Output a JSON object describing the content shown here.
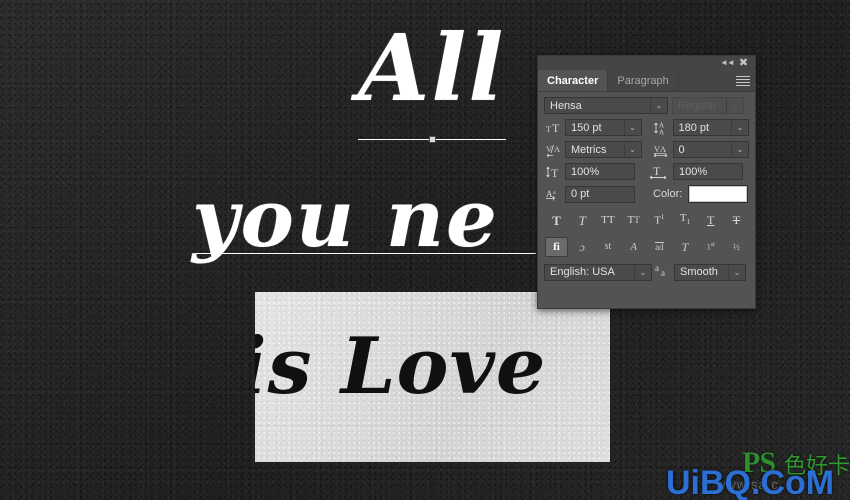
{
  "canvas": {
    "line1": "All",
    "line2": "you ne",
    "line3": "is Love",
    "background_color": "#252525",
    "text_color": "#ffffff",
    "box_background": "#dcdcdc",
    "box_text_color": "#101010"
  },
  "watermark": {
    "ps_logo": "PS",
    "cn_logo": "色好卡",
    "domain": "UiBQ.CoM",
    "sub": "www.sa.c",
    "blue": "#2b6fd4",
    "green": "#2d8f2d"
  },
  "panel": {
    "titlebar": {
      "collapse_icon": "double-chevron-left-icon",
      "close_icon": "close-icon"
    },
    "tabs": [
      {
        "label": "Character",
        "active": true
      },
      {
        "label": "Paragraph",
        "active": false
      }
    ],
    "menu_icon": "hamburger-menu-icon",
    "font_family": {
      "icon": "",
      "value": "Hensa",
      "caret": "⌄"
    },
    "font_style": {
      "value": "Regular",
      "disabled": true,
      "caret": "⌄"
    },
    "size": {
      "icon_label": "font-size-icon",
      "value": "150 pt",
      "caret": "⌄"
    },
    "leading": {
      "icon_label": "leading-icon",
      "value": "180 pt",
      "caret": "⌄"
    },
    "kerning": {
      "icon_label": "kerning-icon",
      "value": "Metrics",
      "caret": "⌄"
    },
    "tracking": {
      "icon_label": "tracking-icon",
      "value": "0",
      "caret": "⌄"
    },
    "vertical_scale": {
      "icon_label": "vertical-scale-icon",
      "value": "100%"
    },
    "horizontal_scale": {
      "icon_label": "horizontal-scale-icon",
      "value": "100%"
    },
    "baseline_shift": {
      "icon_label": "baseline-shift-icon",
      "value": "0 pt"
    },
    "color": {
      "label": "Color:",
      "swatch_hex": "#ffffff"
    },
    "style_buttons": [
      {
        "name": "faux-bold",
        "glyph": "T",
        "active": false
      },
      {
        "name": "faux-italic",
        "glyph": "T",
        "active": false
      },
      {
        "name": "all-caps",
        "glyph": "TT",
        "active": false
      },
      {
        "name": "small-caps",
        "glyph": "Tт",
        "active": false
      },
      {
        "name": "superscript",
        "glyph": "T",
        "active": false
      },
      {
        "name": "subscript",
        "glyph": "T",
        "active": false
      },
      {
        "name": "underline",
        "glyph": "T",
        "active": false
      },
      {
        "name": "strikethrough",
        "glyph": "T",
        "active": false
      }
    ],
    "opentype_buttons": [
      {
        "name": "standard-ligatures",
        "glyph": "fi",
        "active": true
      },
      {
        "name": "contextual-alternates",
        "glyph": "ɔ",
        "active": false
      },
      {
        "name": "discretionary-ligatures",
        "glyph": "st",
        "active": false
      },
      {
        "name": "swash",
        "glyph": "A",
        "active": false
      },
      {
        "name": "old-style",
        "glyph": "ad",
        "active": false
      },
      {
        "name": "stylistic-alternates",
        "glyph": "T",
        "active": false
      },
      {
        "name": "ordinals",
        "glyph": "1st",
        "active": false
      },
      {
        "name": "fractions",
        "glyph": "½",
        "active": false
      }
    ],
    "language": {
      "value": "English: USA",
      "caret": "⌄"
    },
    "anti_alias": {
      "icon_label": "anti-alias-icon",
      "glyph": "aa",
      "value": "Smooth",
      "caret": "⌄"
    }
  }
}
